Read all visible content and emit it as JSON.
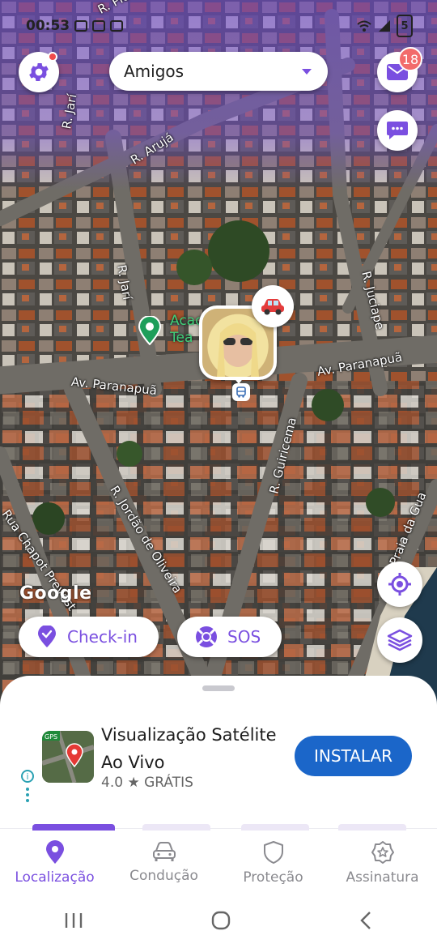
{
  "status_bar": {
    "time": "00:53",
    "battery": "5"
  },
  "top_bar": {
    "group_selector": "Amigos",
    "mail_badge": "18"
  },
  "map": {
    "streets": [
      "R. Pio",
      "R. Jarí",
      "R. Arujá",
      "R. Jarí",
      "R. Juciape",
      "Av. Paranapuã",
      "Av. Paranapuã",
      "R. Guiricema",
      "R. Jordão de Oliveira",
      "Rua Chapot Prevost",
      "Praia da Gua"
    ],
    "place_label": [
      "Acad",
      "Tea"
    ],
    "attribution": "Google"
  },
  "actions": {
    "checkin": "Check-in",
    "sos": "SOS"
  },
  "ad": {
    "title": "Visualização Satélite Ao Vivo",
    "rating": "4.0 ★ GRÁTIS",
    "install": "INSTALAR"
  },
  "nav": {
    "items": [
      {
        "label": "Localização",
        "icon": "location-pin-icon",
        "active": true
      },
      {
        "label": "Condução",
        "icon": "car-icon",
        "active": false
      },
      {
        "label": "Proteção",
        "icon": "shield-icon",
        "active": false
      },
      {
        "label": "Assinatura",
        "icon": "star-badge-icon",
        "active": false
      }
    ]
  },
  "colors": {
    "accent": "#7a4fe0",
    "install": "#1b66c9",
    "badge": "#f26b6b",
    "place": "#3fcf7a"
  }
}
